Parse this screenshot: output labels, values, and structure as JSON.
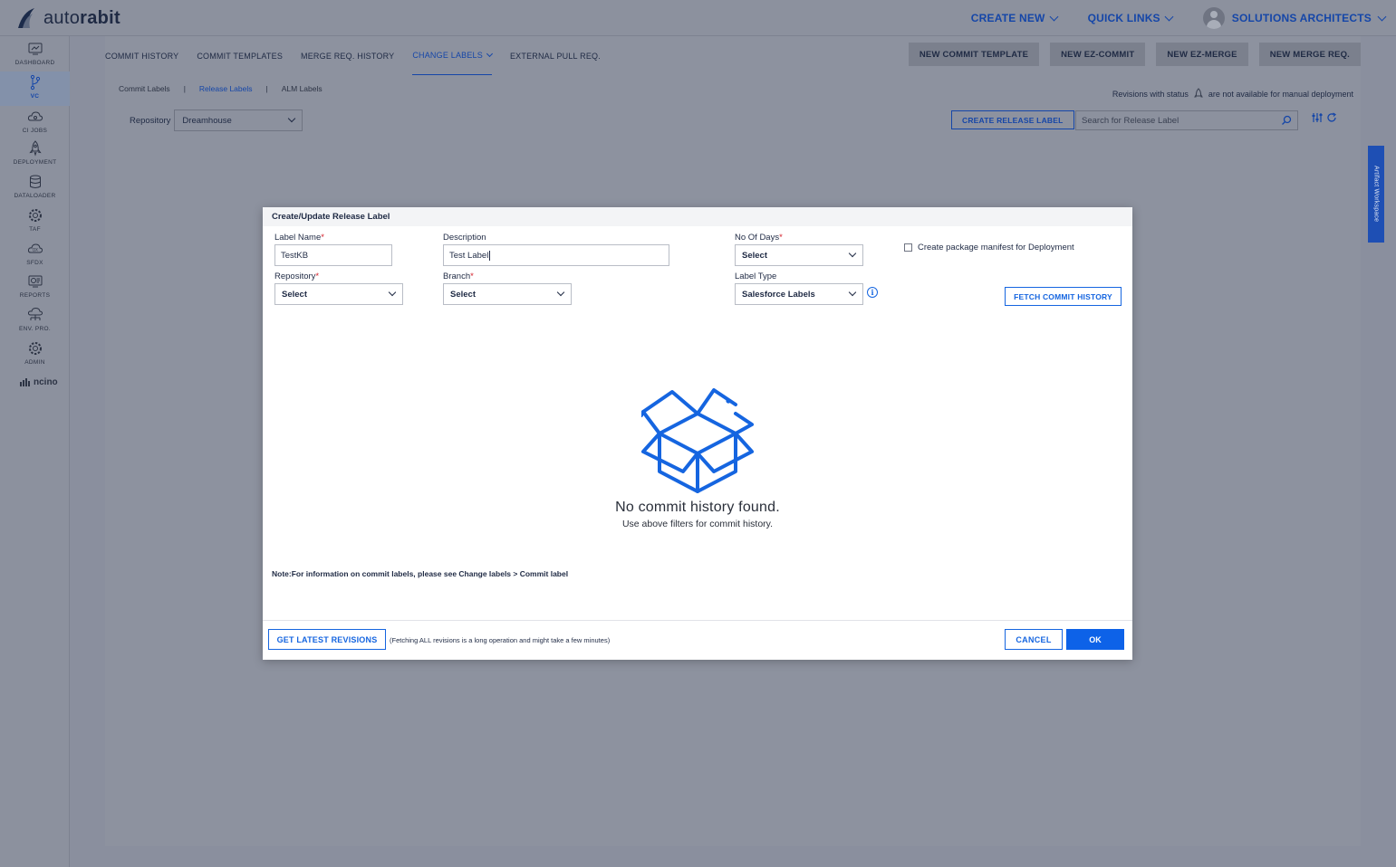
{
  "app": {
    "logo_light": "auto",
    "logo_bold": "rabit"
  },
  "topbar": {
    "create_new": "CREATE NEW",
    "quick_links": "QUICK LINKS",
    "user_name": "SOLUTIONS ARCHITECTS"
  },
  "sidebar": {
    "items": [
      {
        "label": "DASHBOARD",
        "icon": "dashboard-icon"
      },
      {
        "label": "VC",
        "icon": "version-control-icon"
      },
      {
        "label": "CI JOBS",
        "icon": "cloud-ci-icon"
      },
      {
        "label": "DEPLOYMENT",
        "icon": "rocket-icon"
      },
      {
        "label": "DATALOADER",
        "icon": "database-icon"
      },
      {
        "label": "TAF",
        "icon": "gear-icon"
      },
      {
        "label": "SFDX",
        "icon": "cloud-dx-icon"
      },
      {
        "label": "REPORTS",
        "icon": "reports-icon"
      },
      {
        "label": "ENV. PRO.",
        "icon": "environment-icon"
      },
      {
        "label": "ADMIN",
        "icon": "admin-gear-icon"
      }
    ],
    "ncino": "ncino"
  },
  "main": {
    "tabs": [
      {
        "label": "COMMIT HISTORY"
      },
      {
        "label": "COMMIT TEMPLATES"
      },
      {
        "label": "MERGE REQ. HISTORY"
      },
      {
        "label": "CHANGE LABELS"
      },
      {
        "label": "EXTERNAL PULL REQ."
      }
    ],
    "actions": {
      "new_commit_template": "NEW COMMIT TEMPLATE",
      "new_ez_commit": "NEW EZ-COMMIT",
      "new_ez_merge": "NEW EZ-MERGE",
      "new_merge_req": "NEW MERGE REQ."
    },
    "subtabs": {
      "commit_labels": "Commit Labels",
      "sep": "|",
      "release_labels": "Release Labels",
      "alm_labels": "ALM Labels"
    },
    "notice_before": "Revisions with status",
    "notice_after": "are not available for manual deployment",
    "repository_label": "Repository",
    "repository_value": "Dreamhouse",
    "create_release_label": "CREATE RELEASE LABEL",
    "search_placeholder": "Search for Release Label",
    "artifact_workspace": "Artifact Workspace"
  },
  "modal": {
    "title": "Create/Update Release Label",
    "label_name_label": "Label Name",
    "label_name_value": "TestKB",
    "description_label": "Description",
    "description_value": "Test Label",
    "no_of_days_label": "No Of Days",
    "no_of_days_value": "Select",
    "create_manifest_label": "Create package manifest for Deployment",
    "repository_label": "Repository",
    "repository_value": "Select",
    "branch_label": "Branch",
    "branch_value": "Select",
    "label_type_label": "Label Type",
    "label_type_value": "Salesforce Labels",
    "required_mark": "*",
    "info_glyph": "i",
    "fetch_commit_history": "FETCH COMMIT HISTORY",
    "empty_title": "No commit history found.",
    "empty_subtitle": "Use above filters for commit history.",
    "note": "Note:For information on commit labels, please see Change labels > Commit label",
    "get_latest_revisions": "GET LATEST REVISIONS",
    "fetching_note": "(Fetching ALL revisions is a long operation and might take a few minutes)",
    "cancel": "CANCEL",
    "ok": "OK"
  },
  "colors": {
    "accent": "#1565e0",
    "primary_button": "#0d62e8",
    "required": "#d4202a",
    "overlay_bg": "#8a8f9e"
  }
}
